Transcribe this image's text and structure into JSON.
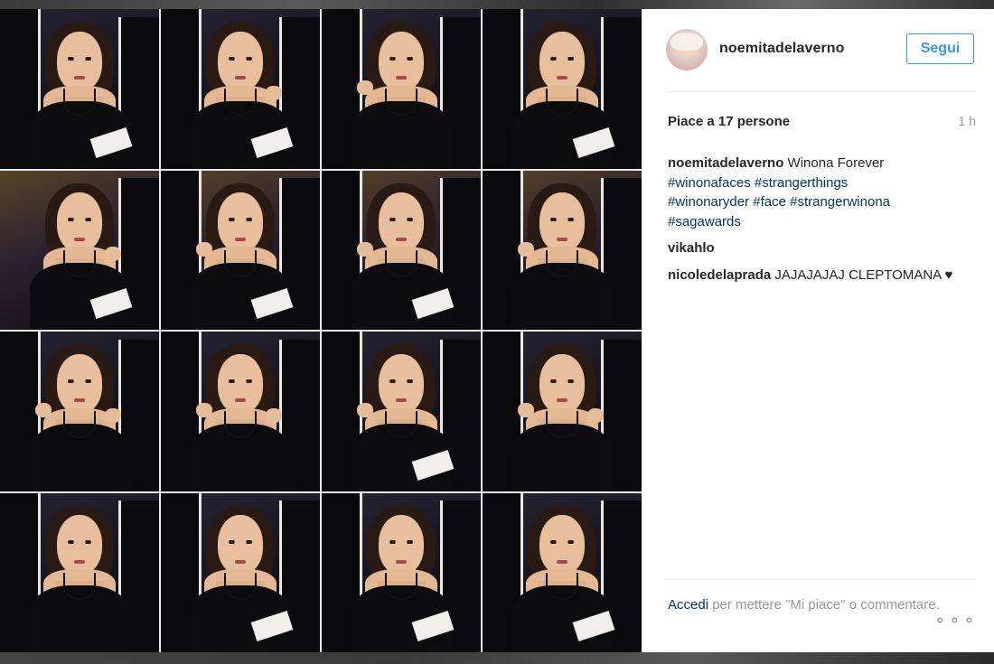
{
  "post": {
    "username": "noemitadelaverno",
    "follow_label": "Segui",
    "likes_text": "Piace a 17 persone",
    "time": "1 h",
    "caption": {
      "user": "noemitadelaverno",
      "text": "Winona Forever",
      "hashtags": [
        "#winonafaces",
        "#strangerthings",
        "#winonaryder",
        "#face",
        "#strangerwinona",
        "#sagawards"
      ]
    },
    "comments": [
      {
        "user": "vikahlo",
        "text": ""
      },
      {
        "user": "nicoledelaprada",
        "text": "JAJAJAJAJ CLEPTOMANA ♥"
      }
    ],
    "footer": {
      "login_link": "Accedi",
      "rest": " per mettere \"Mi piace\" o commentare."
    },
    "more_label": "⚬⚬⚬"
  }
}
